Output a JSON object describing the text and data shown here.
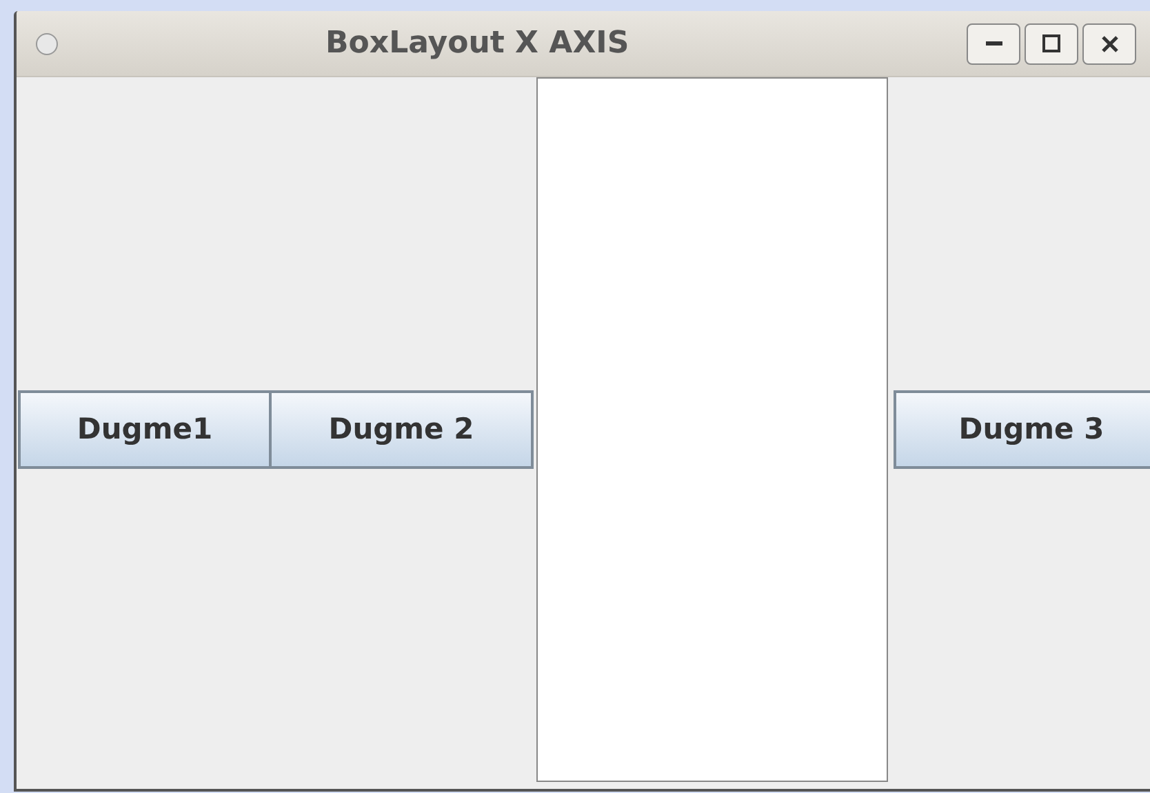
{
  "window": {
    "title": "BoxLayout X AXIS"
  },
  "content": [
    {
      "kind": "button",
      "label": "Dugme1"
    },
    {
      "kind": "button",
      "label": "Dugme 2"
    },
    {
      "kind": "text_area"
    },
    {
      "kind": "button",
      "label": "Dugme 3"
    }
  ]
}
